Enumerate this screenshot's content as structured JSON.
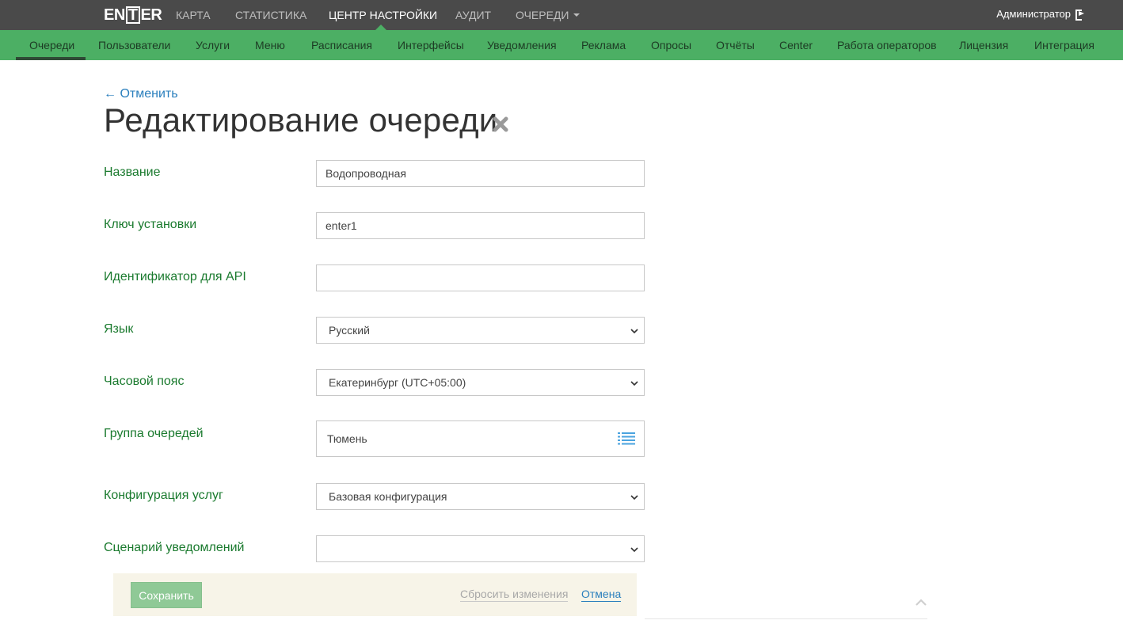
{
  "logo": {
    "part1": "EN",
    "part2": "T",
    "part3": "ER"
  },
  "topnav": [
    {
      "label": "КАРТА"
    },
    {
      "label": "СТАТИСТИКА"
    },
    {
      "label": "ЦЕНТР НАСТРОЙКИ",
      "active": true
    },
    {
      "label": "АУДИТ"
    },
    {
      "label": "ОЧЕРЕДИ"
    }
  ],
  "user": {
    "name": "Администратор"
  },
  "subnav": [
    {
      "label": "Очереди",
      "active": true
    },
    {
      "label": "Пользователи"
    },
    {
      "label": "Услуги"
    },
    {
      "label": "Меню"
    },
    {
      "label": "Расписания"
    },
    {
      "label": "Интерфейсы"
    },
    {
      "label": "Уведомления"
    },
    {
      "label": "Реклама"
    },
    {
      "label": "Опросы"
    },
    {
      "label": "Отчёты"
    },
    {
      "label": "Center"
    },
    {
      "label": "Работа операторов"
    },
    {
      "label": "Лицензия"
    },
    {
      "label": "Интеграция"
    }
  ],
  "page": {
    "back_label": "← Отменить",
    "title": "Редактирование очереди"
  },
  "form": {
    "name": {
      "label": "Название",
      "value": "Водопроводная"
    },
    "install_key": {
      "label": "Ключ установки",
      "value": "enter1"
    },
    "api_id": {
      "label": "Идентификатор для API",
      "value": ""
    },
    "language": {
      "label": "Язык",
      "value": "Русский"
    },
    "timezone": {
      "label": "Часовой пояс",
      "value": "Екатеринбург (UTC+05:00)"
    },
    "queue_group": {
      "label": "Группа очередей",
      "value": "Тюмень"
    },
    "service_config": {
      "label": "Конфигурация услуг",
      "value": "Базовая конфигурация"
    },
    "notify_scenario": {
      "label": "Сценарий уведомлений",
      "value": ""
    }
  },
  "actions": {
    "save_label": "Сохранить",
    "reset_label": "Сбросить изменения",
    "cancel_label": "Отмена"
  },
  "colors": {
    "topbar": "#4a4a4a",
    "subbar": "#4caf64",
    "label_green": "#1a7a2e",
    "link_blue": "#2a7fbd"
  }
}
